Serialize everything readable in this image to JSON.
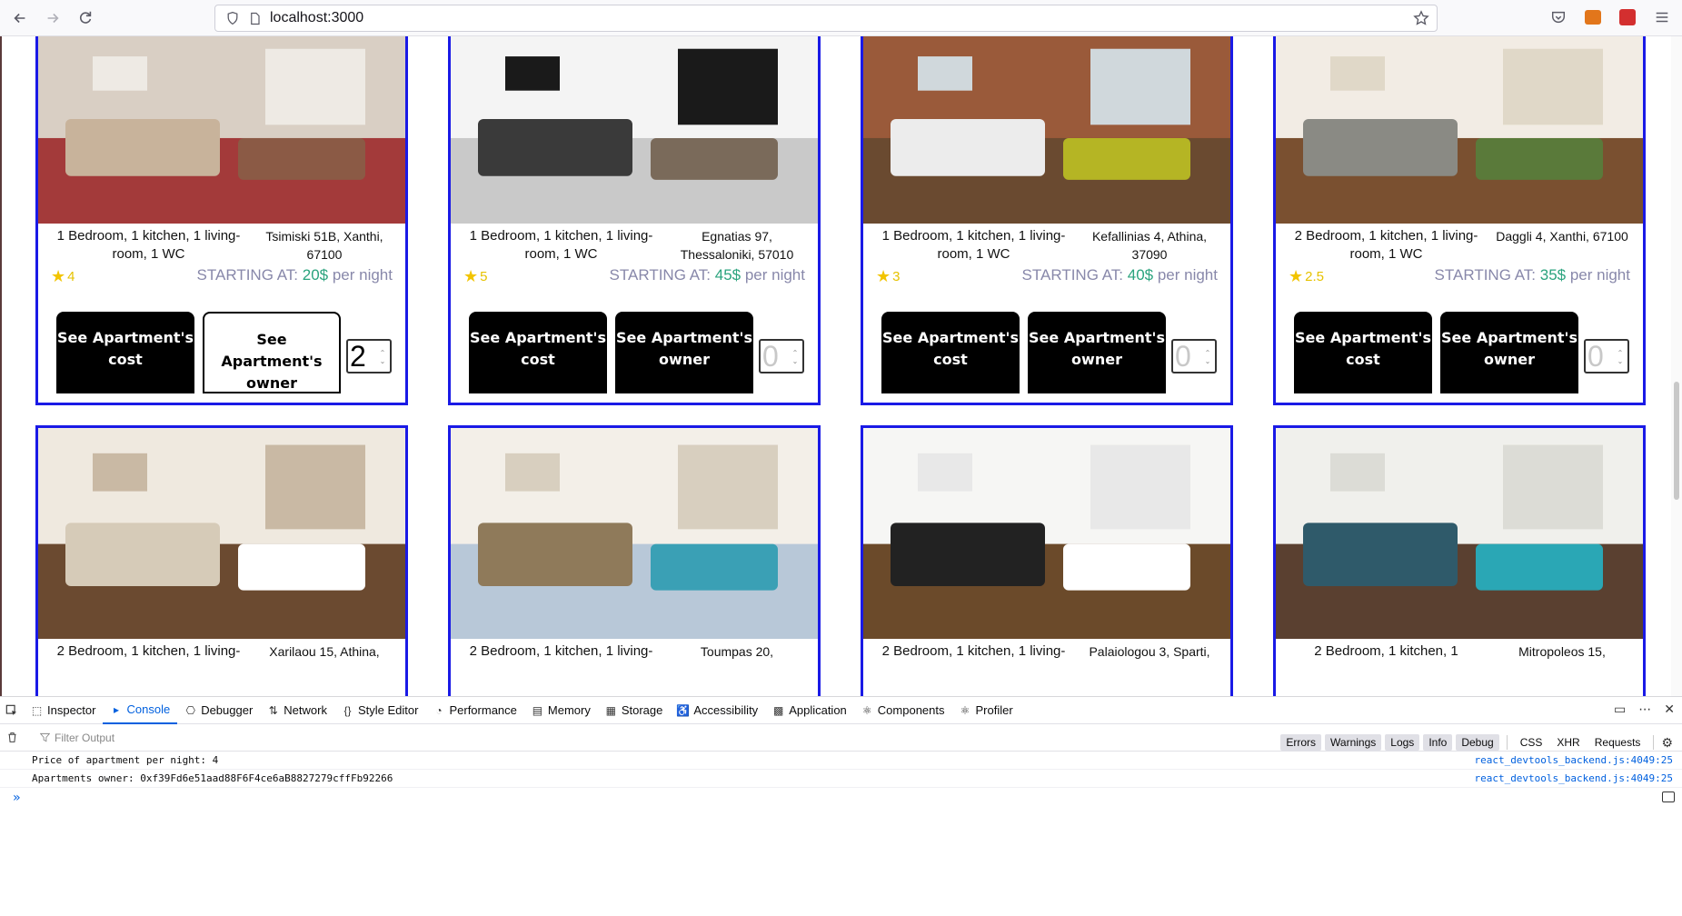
{
  "browser": {
    "url": "localhost:3000"
  },
  "cards": [
    {
      "desc": "1 Bedroom, 1 kitchen, 1 living-room, 1 WC",
      "addr": "Tsimiski 51B, Xanthi, 67100",
      "rating": "4",
      "price_prefix": "STARTING AT:",
      "price_amount": "20$",
      "price_suffix": "per night",
      "btn_cost": "See Apartment's cost",
      "btn_owner": "See Apartment's owner",
      "qty": "2",
      "photo_colors": [
        "#d9cfc4",
        "#c8b39b",
        "#8b5a45",
        "#a33a3a",
        "#eeeae4"
      ]
    },
    {
      "desc": "1 Bedroom, 1 kitchen, 1 living-room, 1 WC",
      "addr": "Egnatias 97, Thessaloniki, 57010",
      "rating": "5",
      "price_prefix": "STARTING AT:",
      "price_amount": "45$",
      "price_suffix": "per night",
      "btn_cost": "See Apartment's cost",
      "btn_owner": "See Apartment's owner",
      "qty": "0",
      "photo_colors": [
        "#f4f4f4",
        "#3a3a3a",
        "#7a6a5a",
        "#c9c9c9",
        "#1a1a1a"
      ]
    },
    {
      "desc": "1 Bedroom, 1 kitchen, 1 living-room, 1 WC",
      "addr": "Kefallinias 4, Athina, 37090",
      "rating": "3",
      "price_prefix": "STARTING AT:",
      "price_amount": "40$",
      "price_suffix": "per night",
      "btn_cost": "See Apartment's cost",
      "btn_owner": "See Apartment's owner",
      "qty": "0",
      "photo_colors": [
        "#9a5a3a",
        "#ececec",
        "#b5b524",
        "#6a4a30",
        "#d0d8dc"
      ]
    },
    {
      "desc": "2 Bedroom, 1 kitchen, 1 living-room, 1 WC",
      "addr": "Daggli 4, Xanthi, 67100",
      "rating": "2.5",
      "price_prefix": "STARTING AT:",
      "price_amount": "35$",
      "price_suffix": "per night",
      "btn_cost": "See Apartment's cost",
      "btn_owner": "See Apartment's owner",
      "qty": "0",
      "photo_colors": [
        "#f2ece4",
        "#8a8a84",
        "#5a7a3a",
        "#7a5030",
        "#e0d8c8"
      ]
    },
    {
      "desc": "2 Bedroom, 1 kitchen, 1 living-",
      "addr": "Xarilaou 15, Athina,",
      "photo_colors": [
        "#efe9df",
        "#d6cbb8",
        "#ffffff",
        "#6b4a30",
        "#c9b9a4"
      ]
    },
    {
      "desc": "2 Bedroom, 1 kitchen, 1 living-",
      "addr": "Toumpas 20,",
      "photo_colors": [
        "#f3efe8",
        "#8f7a5a",
        "#3aa0b5",
        "#b8c8d8",
        "#d8cfbf"
      ]
    },
    {
      "desc": "2 Bedroom, 1 kitchen, 1 living-",
      "addr": "Palaiologou 3, Sparti,",
      "photo_colors": [
        "#f6f6f4",
        "#222222",
        "#ffffff",
        "#6b4a2a",
        "#e8e8e8"
      ]
    },
    {
      "desc": "2 Bedroom, 1 kitchen, 1",
      "addr": "Mitropoleos 15,",
      "photo_colors": [
        "#f0f0ec",
        "#2f5a6a",
        "#2aa7b5",
        "#5a4030",
        "#dcdcd6"
      ]
    }
  ],
  "devtools": {
    "tabs": [
      {
        "label": "Inspector",
        "icon": "inspector-icon"
      },
      {
        "label": "Console",
        "icon": "console-icon"
      },
      {
        "label": "Debugger",
        "icon": "debugger-icon"
      },
      {
        "label": "Network",
        "icon": "network-icon"
      },
      {
        "label": "Style Editor",
        "icon": "style-editor-icon"
      },
      {
        "label": "Performance",
        "icon": "performance-icon"
      },
      {
        "label": "Memory",
        "icon": "memory-icon"
      },
      {
        "label": "Storage",
        "icon": "storage-icon"
      },
      {
        "label": "Accessibility",
        "icon": "accessibility-icon"
      },
      {
        "label": "Application",
        "icon": "application-icon"
      },
      {
        "label": "Components",
        "icon": "react-components-icon"
      },
      {
        "label": "Profiler",
        "icon": "react-profiler-icon"
      }
    ],
    "active_tab": "Console",
    "filter_placeholder": "Filter Output",
    "levels": [
      "Errors",
      "Warnings",
      "Logs",
      "Info",
      "Debug"
    ],
    "extra_filters": [
      "CSS",
      "XHR",
      "Requests"
    ],
    "logs": [
      {
        "text": "Price of apartment per night:  4",
        "source": "react_devtools_backend.js:4049:25"
      },
      {
        "text": "Apartments owner:  0xf39Fd6e51aad88F6F4ce6aB8827279cffFb92266",
        "source": "react_devtools_backend.js:4049:25"
      }
    ],
    "prompt": "»"
  }
}
